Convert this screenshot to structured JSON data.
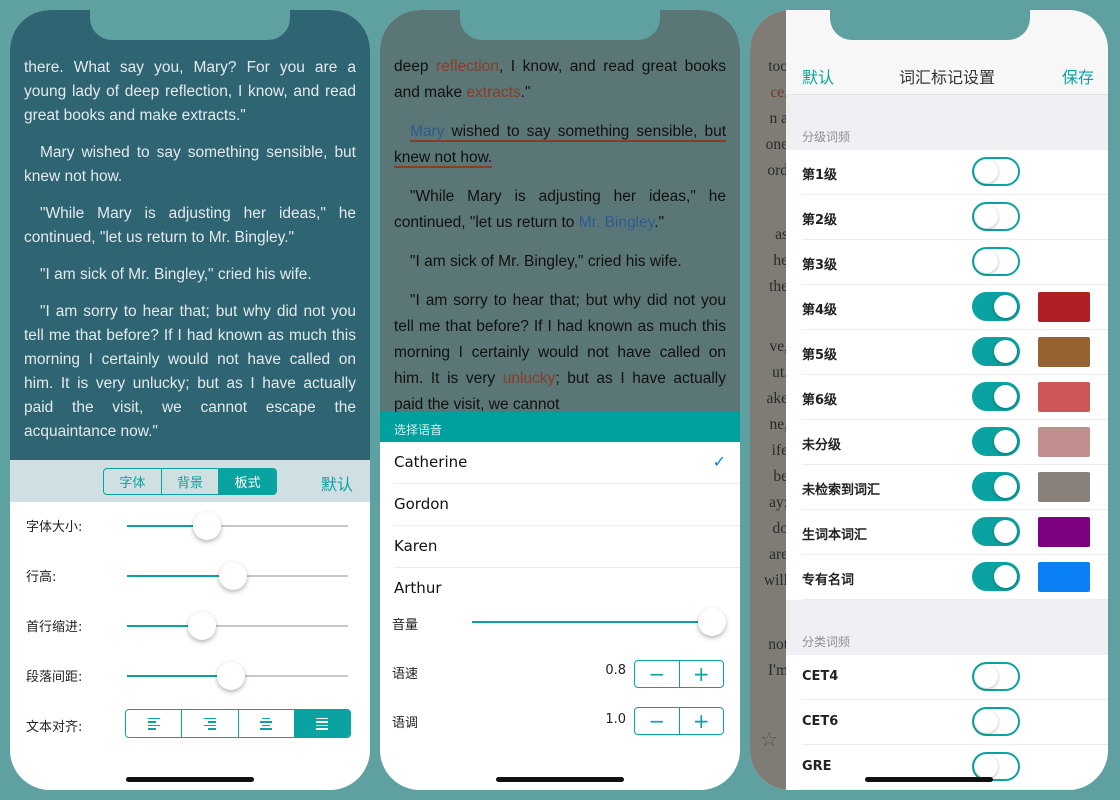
{
  "phone1": {
    "paragraphs": [
      "there. What say you, Mary? For you are a young lady of deep reflection, I know, and read great books and make extracts.\"",
      "Mary wished to say something sensible, but knew not how.",
      "\"While Mary is adjusting her ideas,\" he continued, \"let us return to Mr. Bingley.\"",
      "\"I am sick of Mr. Bingley,\" cried his wife.",
      "\"I am sorry to hear that; but why did not you tell me that before? If I had known as much this morning I certainly would not have called on him. It is very unlucky; but as I have actually paid the visit, we cannot escape the acquaintance now.\""
    ],
    "tabs": [
      {
        "label": "字体",
        "active": false
      },
      {
        "label": "背景",
        "active": false
      },
      {
        "label": "板式",
        "active": true
      }
    ],
    "default_label": "默认",
    "sliders": [
      {
        "label": "字体大小:",
        "value": 0.36
      },
      {
        "label": "行高:",
        "value": 0.48
      },
      {
        "label": "首行缩进:",
        "value": 0.34
      },
      {
        "label": "段落间距:",
        "value": 0.47
      }
    ],
    "align_label": "文本对齐:",
    "align_options": [
      {
        "icon": "align-left-icon",
        "active": false
      },
      {
        "icon": "align-right-icon",
        "active": false
      },
      {
        "icon": "align-center-icon",
        "active": false
      },
      {
        "icon": "align-justify-icon",
        "active": true
      }
    ]
  },
  "phone2": {
    "text": {
      "l1a": "deep ",
      "l1r": "reflection",
      "l1b": ", I know, and read great books and make ",
      "l1r2": "extracts",
      "l1c": ".\"",
      "p2name": "Mary",
      "p2rest": " wished to say something sensible, but knew not how.",
      "p3a": "\"While Mary is adjusting her ideas,\" he continued, \"let us return to ",
      "p3b": "Mr. Bingley",
      "p3c": ".\"",
      "p4": "\"I am sick of Mr. Bingley,\" cried his wife.",
      "p5a": "\"I am sorry to hear that; but why did not you tell me that before? If I had known as much this morning I certainly would not have called on him. It is very ",
      "p5r": "unlucky",
      "p5b": "; but as I have actually paid the visit, we cannot"
    },
    "voice_header": "选择语音",
    "voices": [
      {
        "name": "Catherine",
        "selected": true
      },
      {
        "name": "Gordon",
        "selected": false
      },
      {
        "name": "Karen",
        "selected": false
      },
      {
        "name": "Arthur",
        "selected": false
      }
    ],
    "volume": {
      "label": "音量",
      "value": 1.0
    },
    "rate": {
      "label": "语速",
      "value": "0.8"
    },
    "pitch": {
      "label": "语调",
      "value": "1.0"
    },
    "minus": "−",
    "plus": "+"
  },
  "phone3": {
    "sliver": [
      "too",
      "ce.",
      "n a",
      "one",
      "ord",
      "as",
      "he",
      "the",
      "ve,",
      "ut.",
      "ake",
      "ne,",
      "ife",
      "be",
      "ay;",
      "do",
      "are",
      "will",
      "not",
      "I'm"
    ],
    "header": {
      "left": "默认",
      "title": "词汇标记设置",
      "right": "保存"
    },
    "section1": "分级词频",
    "rows1": [
      {
        "name": "第1级",
        "on": false
      },
      {
        "name": "第2级",
        "on": false
      },
      {
        "name": "第3级",
        "on": false
      },
      {
        "name": "第4级",
        "on": true,
        "color": "#b01f24"
      },
      {
        "name": "第5级",
        "on": true,
        "color": "#956232"
      },
      {
        "name": "第6级",
        "on": true,
        "color": "#cd5657"
      },
      {
        "name": "未分级",
        "on": true,
        "color": "#c08e8d"
      },
      {
        "name": "未检索到词汇",
        "on": true,
        "color": "#888079"
      },
      {
        "name": "生词本词汇",
        "on": true,
        "color": "#7c0080"
      },
      {
        "name": "专有名词",
        "on": true,
        "color": "#0a80f5"
      }
    ],
    "section2": "分类词频",
    "rows2": [
      {
        "name": "CET4",
        "on": false
      },
      {
        "name": "CET6",
        "on": false
      },
      {
        "name": "GRE",
        "on": false
      }
    ]
  },
  "colors": {
    "accent": "#0aa3a1",
    "background": "#5fa1a0"
  }
}
